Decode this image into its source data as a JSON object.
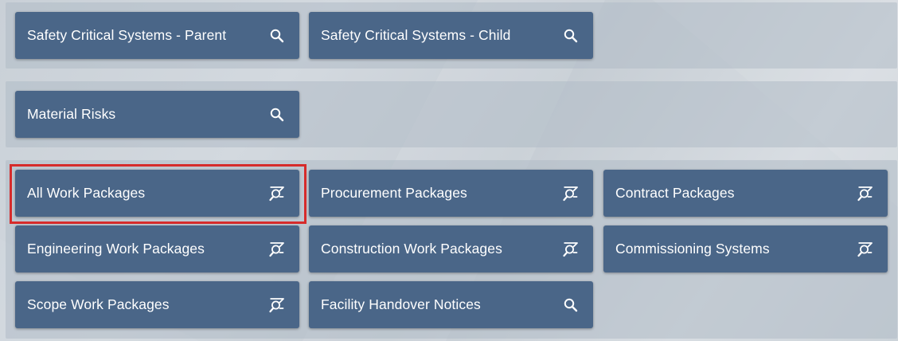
{
  "groups": [
    {
      "tiles": [
        {
          "label": "Safety Critical Systems - Parent",
          "icon": "search-icon"
        },
        {
          "label": "Safety Critical Systems - Child",
          "icon": "search-icon"
        }
      ]
    },
    {
      "tiles": [
        {
          "label": "Material Risks",
          "icon": "search-icon"
        }
      ]
    },
    {
      "tiles": [
        {
          "label": "All Work Packages",
          "icon": "filter-search-icon",
          "highlighted": true
        },
        {
          "label": "Procurement Packages",
          "icon": "filter-search-icon"
        },
        {
          "label": "Contract Packages",
          "icon": "filter-search-icon"
        },
        {
          "label": "Engineering Work Packages",
          "icon": "filter-search-icon"
        },
        {
          "label": "Construction Work Packages",
          "icon": "filter-search-icon"
        },
        {
          "label": "Commissioning Systems",
          "icon": "filter-search-icon"
        },
        {
          "label": "Scope Work Packages",
          "icon": "filter-search-icon"
        },
        {
          "label": "Facility Handover Notices",
          "icon": "search-icon"
        }
      ]
    }
  ],
  "colors": {
    "tile": "#4a6688",
    "highlight": "#d62b2b"
  }
}
